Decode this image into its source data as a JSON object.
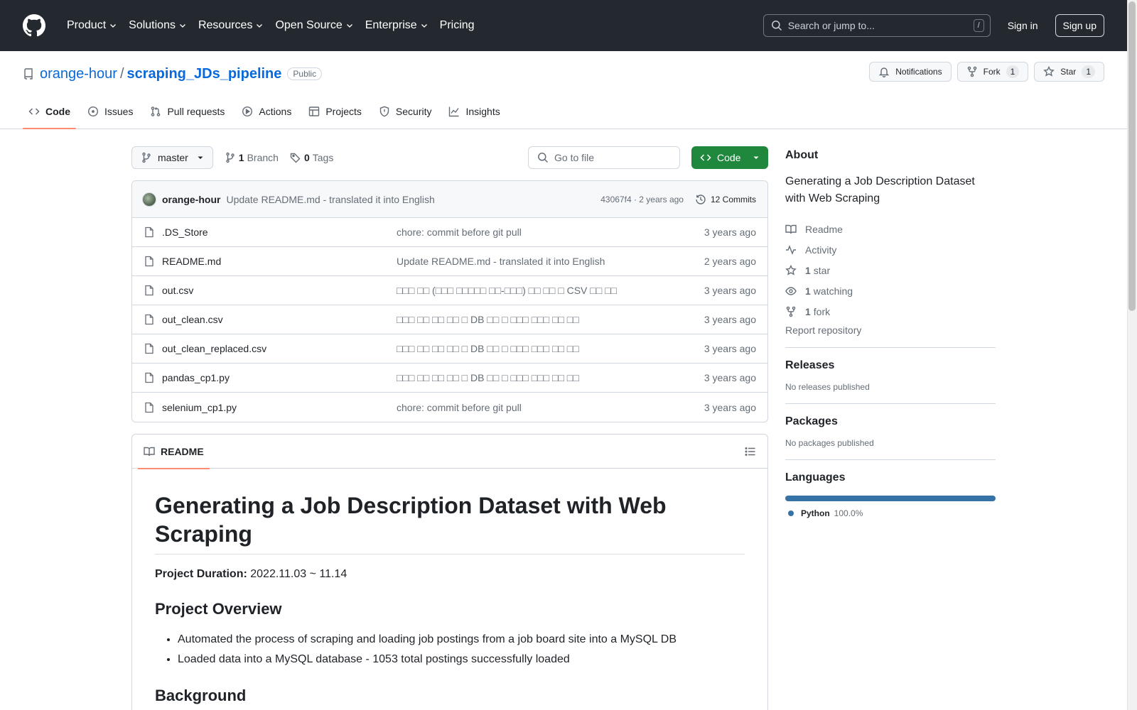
{
  "header": {
    "nav": [
      "Product",
      "Solutions",
      "Resources",
      "Open Source",
      "Enterprise",
      "Pricing"
    ],
    "search_placeholder": "Search or jump to...",
    "search_shortcut": "/",
    "signin": "Sign in",
    "signup": "Sign up"
  },
  "repo": {
    "owner": "orange-hour",
    "separator": "/",
    "name": "scraping_JDs_pipeline",
    "visibility": "Public",
    "notifications": "Notifications",
    "fork_label": "Fork",
    "fork_count": "1",
    "star_label": "Star",
    "star_count": "1",
    "tabs": [
      "Code",
      "Issues",
      "Pull requests",
      "Actions",
      "Projects",
      "Security",
      "Insights"
    ]
  },
  "toolbar": {
    "branch": "master",
    "branch_count": "1",
    "branch_label": "Branch",
    "tag_count": "0",
    "tag_label": "Tags",
    "goto_placeholder": "Go to file",
    "code_button": "Code"
  },
  "commit": {
    "author": "orange-hour",
    "message": "Update README.md - translated it into English",
    "hash_time": "43067f4 · 2 years ago",
    "count": "12 Commits"
  },
  "files": [
    {
      "name": ".DS_Store",
      "message": "chore: commit before git pull",
      "age": "3 years ago"
    },
    {
      "name": "README.md",
      "message": "Update README.md - translated it into English",
      "age": "2 years ago"
    },
    {
      "name": "out.csv",
      "message": "□□□ □□ (□□□ □□□□□ □□-□□□) □□ □□ □ CSV □□ □□",
      "age": "3 years ago"
    },
    {
      "name": "out_clean.csv",
      "message": "□□□ □□ □□ □□ □ DB □□ □ □□□ □□□ □□ □□",
      "age": "3 years ago"
    },
    {
      "name": "out_clean_replaced.csv",
      "message": "□□□ □□ □□ □□ □ DB □□ □ □□□ □□□ □□ □□",
      "age": "3 years ago"
    },
    {
      "name": "pandas_cp1.py",
      "message": "□□□ □□ □□ □□ □ DB □□ □ □□□ □□□ □□ □□",
      "age": "3 years ago"
    },
    {
      "name": "selenium_cp1.py",
      "message": "chore: commit before git pull",
      "age": "3 years ago"
    }
  ],
  "readme": {
    "tab": "README",
    "title": "Generating a Job Description Dataset with Web Scraping",
    "duration_label": "Project Duration:",
    "duration_value": " 2022.11.03 ~ 11.14",
    "overview_heading": "Project Overview",
    "overview_items": [
      "Automated the process of scraping and loading job postings from a job board site into a MySQL DB",
      "Loaded data into a MySQL database - 1053 total postings successfully loaded"
    ],
    "background_heading": "Background"
  },
  "sidebar": {
    "about_heading": "About",
    "description": "Generating a Job Description Dataset with Web Scraping",
    "readme": "Readme",
    "activity": "Activity",
    "stars_count": "1",
    "stars_label": "star",
    "watching_count": "1",
    "watching_label": "watching",
    "forks_count": "1",
    "forks_label": "fork",
    "report": "Report repository",
    "releases_heading": "Releases",
    "releases_text": "No releases published",
    "packages_heading": "Packages",
    "packages_text": "No packages published",
    "languages_heading": "Languages",
    "language_name": "Python",
    "language_pct": "100.0%",
    "language_color": "#3572A5"
  }
}
